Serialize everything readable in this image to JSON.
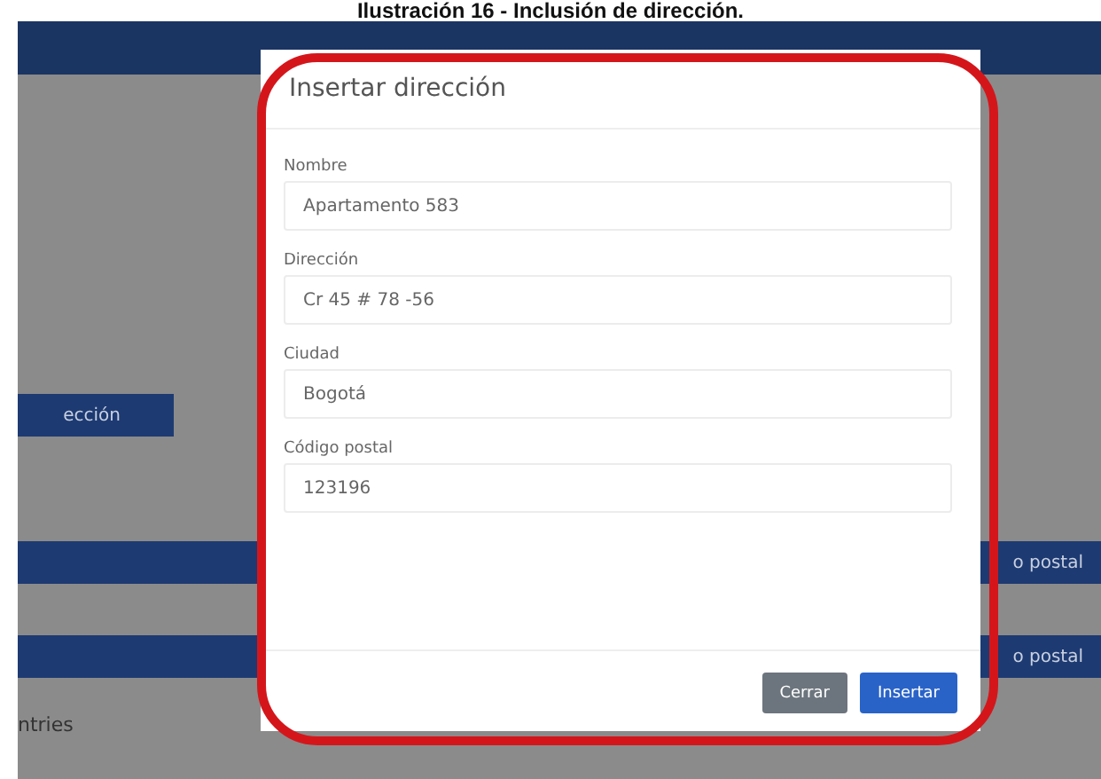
{
  "caption": "Ilustración 16 - Inclusión de dirección.",
  "background": {
    "button_label": "ección",
    "bars": [
      {
        "label": "o postal"
      },
      {
        "label": "o postal"
      }
    ],
    "footer_text": "ntries"
  },
  "modal": {
    "title": "Insertar dirección",
    "fields": [
      {
        "label": "Nombre",
        "value": "Apartamento 583"
      },
      {
        "label": "Dirección",
        "value": "Cr 45 # 78 -56"
      },
      {
        "label": "Ciudad",
        "value": "Bogotá"
      },
      {
        "label": "Código postal",
        "value": "123196"
      }
    ],
    "buttons": [
      {
        "label": "Cerrar",
        "kind": "secondary"
      },
      {
        "label": "Insertar",
        "kind": "primary"
      }
    ]
  }
}
